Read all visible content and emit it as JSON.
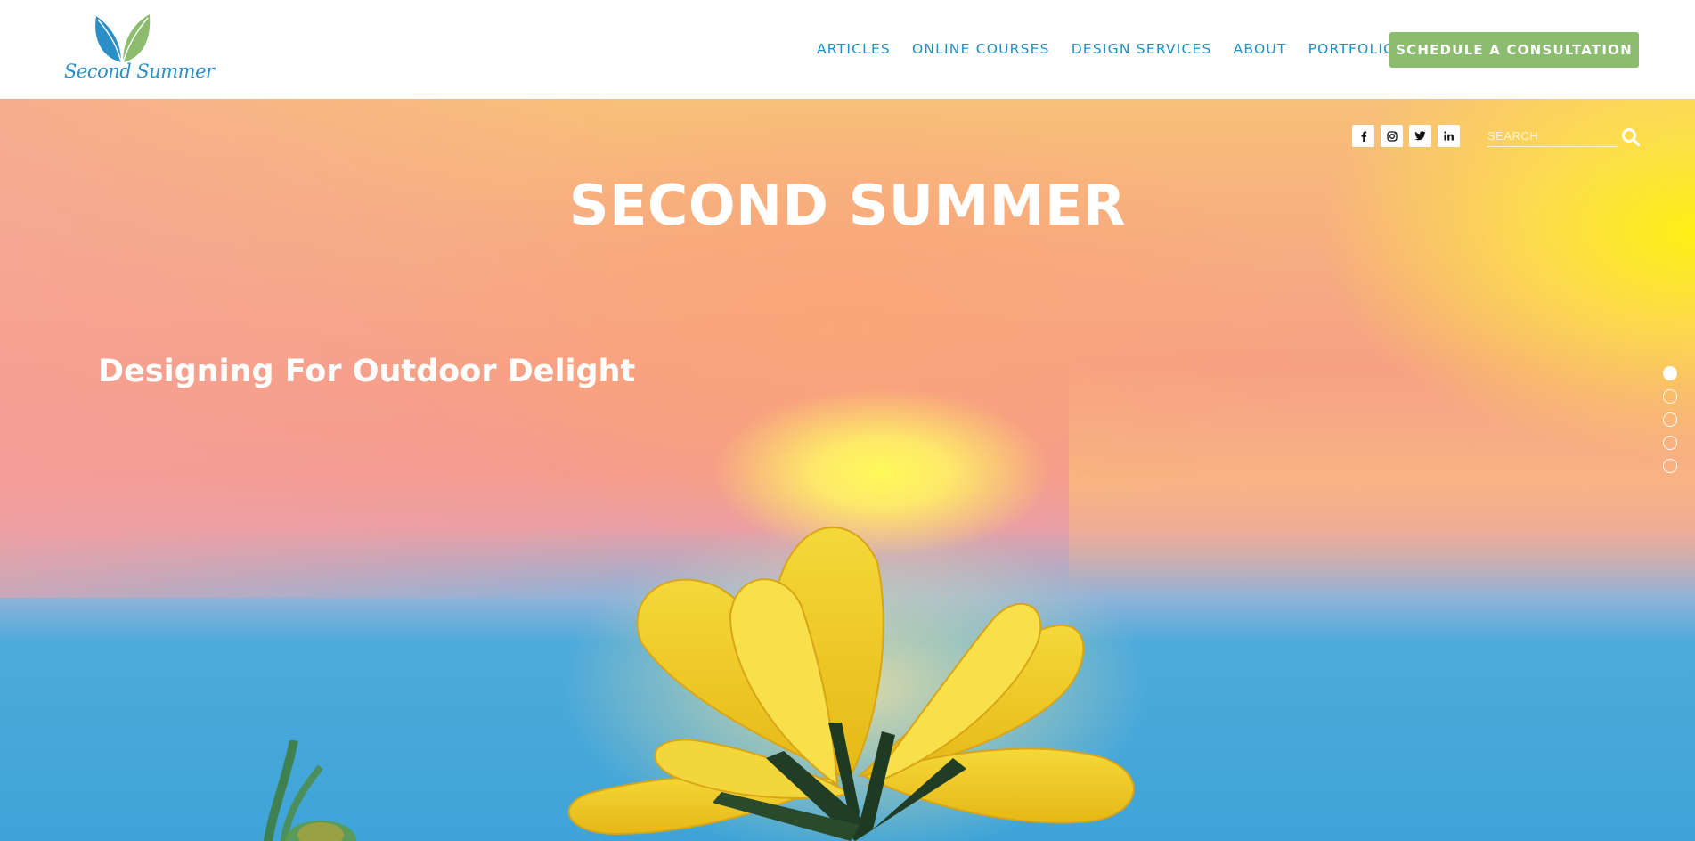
{
  "brand": {
    "logo_text": "Second Summer",
    "leaf_left_color": "#2a8fc7",
    "leaf_right_color": "#8cbd6f"
  },
  "nav": {
    "items": [
      {
        "label": "ARTICLES"
      },
      {
        "label": "ONLINE COURSES"
      },
      {
        "label": "DESIGN SERVICES"
      },
      {
        "label": "ABOUT"
      },
      {
        "label": "PORTFOLIO"
      }
    ],
    "cta_label": "SCHEDULE A CONSULTATION"
  },
  "colors": {
    "nav_text": "#1e8fc4",
    "cta_background": "#8cbd6f",
    "hero_text": "#ffffff"
  },
  "social": [
    {
      "name": "facebook-icon"
    },
    {
      "name": "instagram-icon"
    },
    {
      "name": "twitter-icon"
    },
    {
      "name": "linkedin-icon"
    }
  ],
  "search": {
    "placeholder": "SEARCH",
    "value": ""
  },
  "hero": {
    "title": "SECOND SUMMER",
    "subtitle": "Designing For Outdoor Delight"
  },
  "slider": {
    "count": 5,
    "active_index": 1
  }
}
